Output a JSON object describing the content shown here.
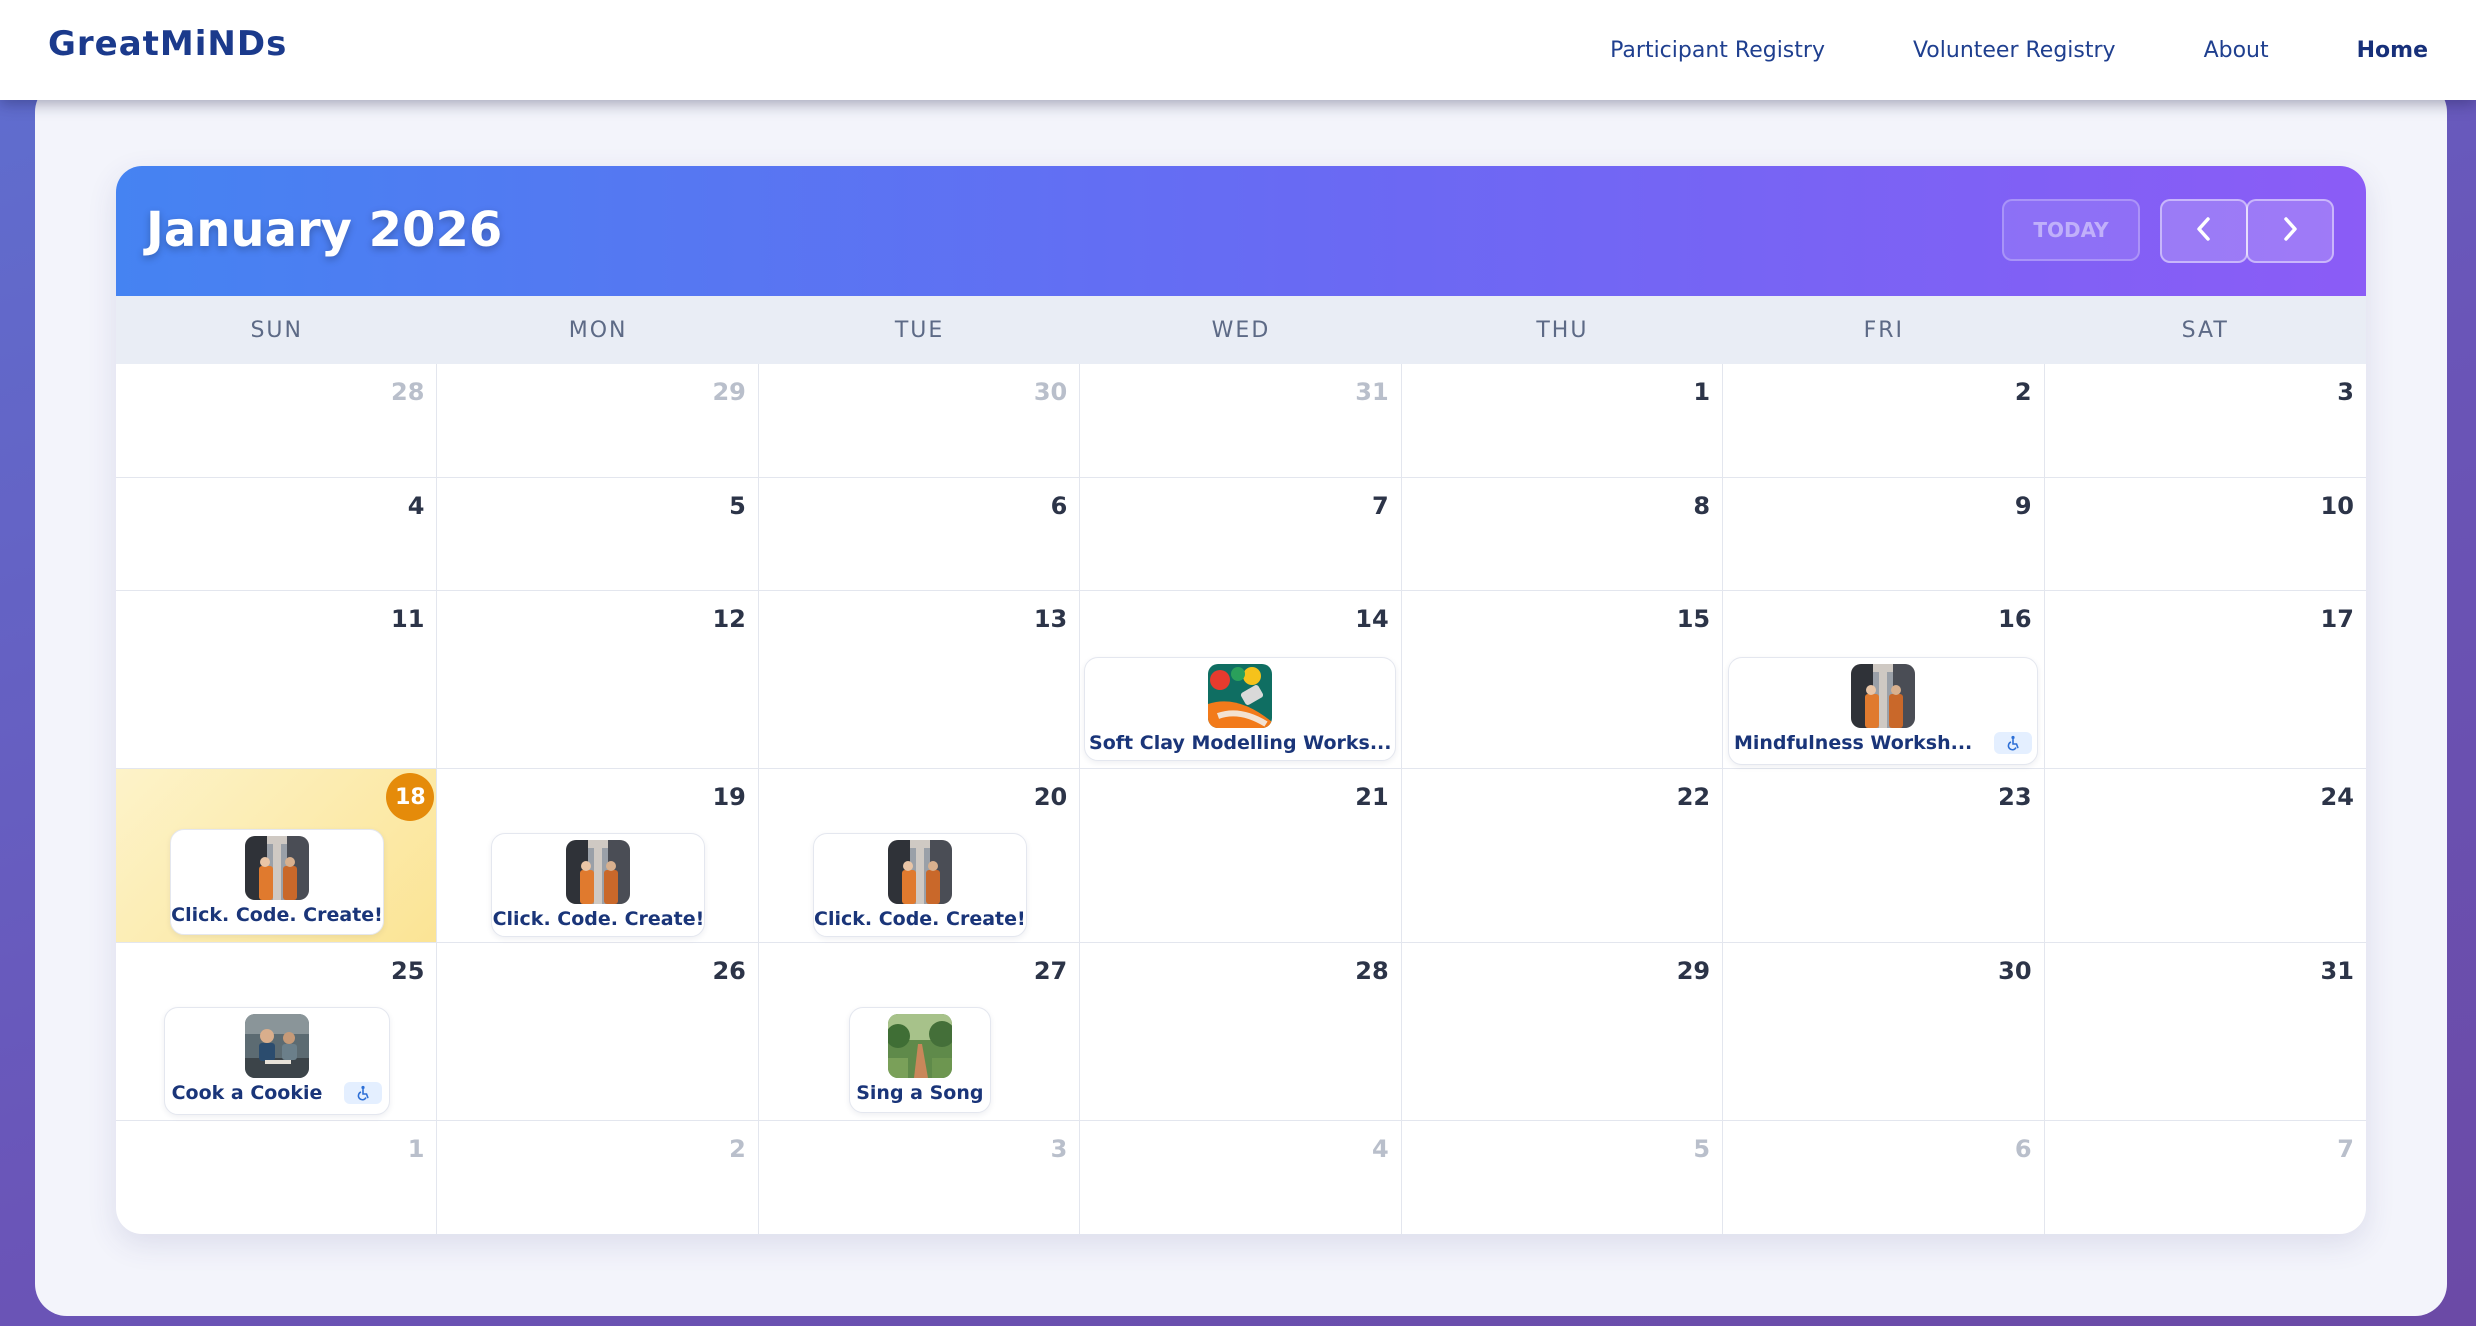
{
  "header": {
    "brand": "GreatMiNDs",
    "nav": [
      {
        "label": "Participant Registry"
      },
      {
        "label": "Volunteer Registry"
      },
      {
        "label": "About"
      },
      {
        "label": "Home"
      }
    ]
  },
  "calendar": {
    "title": "January 2026",
    "today_label": "TODAY",
    "prev_icon": "chevron-left-icon",
    "next_icon": "chevron-right-icon",
    "weekdays": [
      "SUN",
      "MON",
      "TUE",
      "WED",
      "THU",
      "FRI",
      "SAT"
    ],
    "weeks": [
      [
        {
          "d": "28",
          "o": true
        },
        {
          "d": "29",
          "o": true
        },
        {
          "d": "30",
          "o": true
        },
        {
          "d": "31",
          "o": true
        },
        {
          "d": "1"
        },
        {
          "d": "2"
        },
        {
          "d": "3"
        }
      ],
      [
        {
          "d": "4"
        },
        {
          "d": "5"
        },
        {
          "d": "6"
        },
        {
          "d": "7"
        },
        {
          "d": "8"
        },
        {
          "d": "9"
        },
        {
          "d": "10"
        }
      ],
      [
        {
          "d": "11"
        },
        {
          "d": "12"
        },
        {
          "d": "13"
        },
        {
          "d": "14"
        },
        {
          "d": "15"
        },
        {
          "d": "16"
        },
        {
          "d": "17"
        }
      ],
      [
        {
          "d": "18",
          "today": true
        },
        {
          "d": "19"
        },
        {
          "d": "20"
        },
        {
          "d": "21"
        },
        {
          "d": "22"
        },
        {
          "d": "23"
        },
        {
          "d": "24"
        }
      ],
      [
        {
          "d": "25"
        },
        {
          "d": "26"
        },
        {
          "d": "27"
        },
        {
          "d": "28"
        },
        {
          "d": "29"
        },
        {
          "d": "30"
        },
        {
          "d": "31"
        }
      ],
      [
        {
          "d": "1",
          "o": true
        },
        {
          "d": "2",
          "o": true
        },
        {
          "d": "3",
          "o": true
        },
        {
          "d": "4",
          "o": true
        },
        {
          "d": "5",
          "o": true
        },
        {
          "d": "6",
          "o": true
        },
        {
          "d": "7",
          "o": true
        }
      ]
    ],
    "events": {
      "e14": {
        "title": "Soft Clay Modelling Works...",
        "image": "paint-brush-image"
      },
      "e16": {
        "title": "Mindfulness Worksh...",
        "image": "robot-workshop-image",
        "badge": "wheelchair-accessible-icon"
      },
      "e18": {
        "title": "Click. Code. Create!",
        "image": "robot-workshop-image"
      },
      "e19": {
        "title": "Click. Code. Create!",
        "image": "robot-workshop-image"
      },
      "e20": {
        "title": "Click. Code. Create!",
        "image": "robot-workshop-image"
      },
      "e25": {
        "title": "Cook a Cookie",
        "image": "kitchen-cooking-image",
        "badge": "wheelchair-accessible-icon"
      },
      "e27": {
        "title": "Sing a Song",
        "image": "garden-path-image"
      }
    }
  },
  "colors": {
    "brand": "#1b3a8c",
    "header_gradient_start": "#4583f2",
    "header_gradient_end": "#8b5cf6",
    "today_badge": "#e58b0a",
    "today_cell": "#fbe495"
  }
}
